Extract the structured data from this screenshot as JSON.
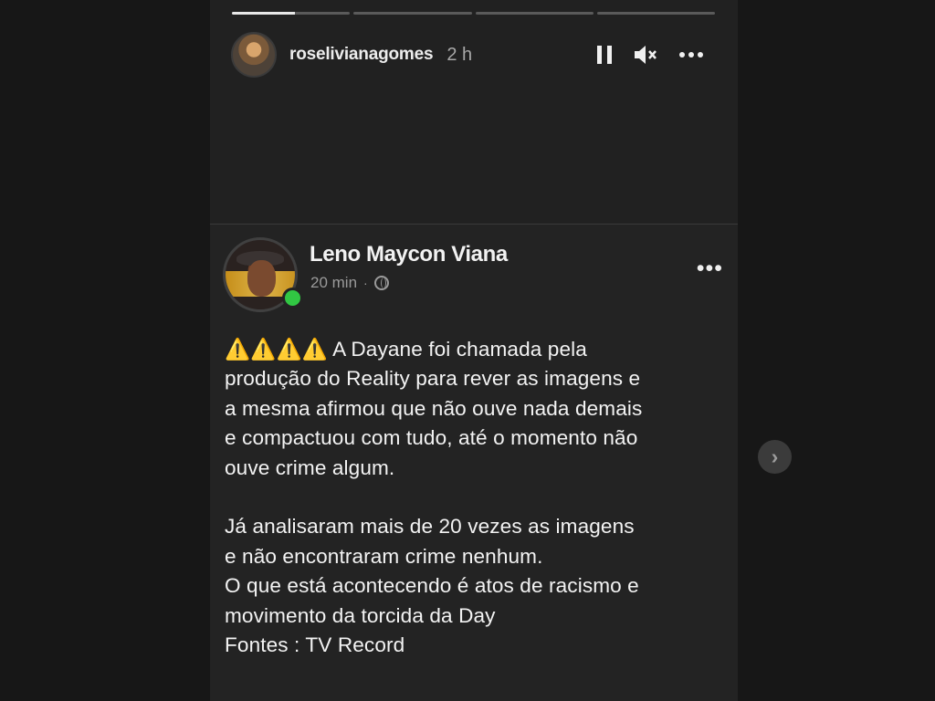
{
  "story": {
    "username": "roselivianagomes",
    "time": "2 h",
    "progress": {
      "segments": [
        {
          "fill": 0.53
        },
        {
          "fill": 0
        },
        {
          "fill": 0
        },
        {
          "fill": 0
        }
      ]
    },
    "controls": {
      "pause_icon": "pause-icon",
      "mute_icon": "muted-speaker-icon",
      "more_icon": "more-horizontal-icon"
    }
  },
  "post": {
    "author": "Leno Maycon Viana",
    "time": "20 min",
    "separator": "·",
    "visibility_icon": "globe-icon",
    "more_label": "•••",
    "warning_icons": "⚠️⚠️⚠️⚠️",
    "text": "A Dayane foi chamada pela\nprodução do Reality para rever as imagens e\na mesma afirmou que não ouve nada demais\ne compactuou com tudo, até o momento não\nouve crime algum.\n\nJá analisaram mais de 20 vezes as imagens\ne não encontraram crime nenhum.\nO que está acontecendo é atos de racismo e\nmovimento da torcida da Day\nFontes : TV Record"
  },
  "navigation": {
    "next_label": "›"
  },
  "colors": {
    "story_bg": "#212121",
    "page_bg": "#161616",
    "online_status": "#31c743",
    "warning": "#f4d53b"
  }
}
